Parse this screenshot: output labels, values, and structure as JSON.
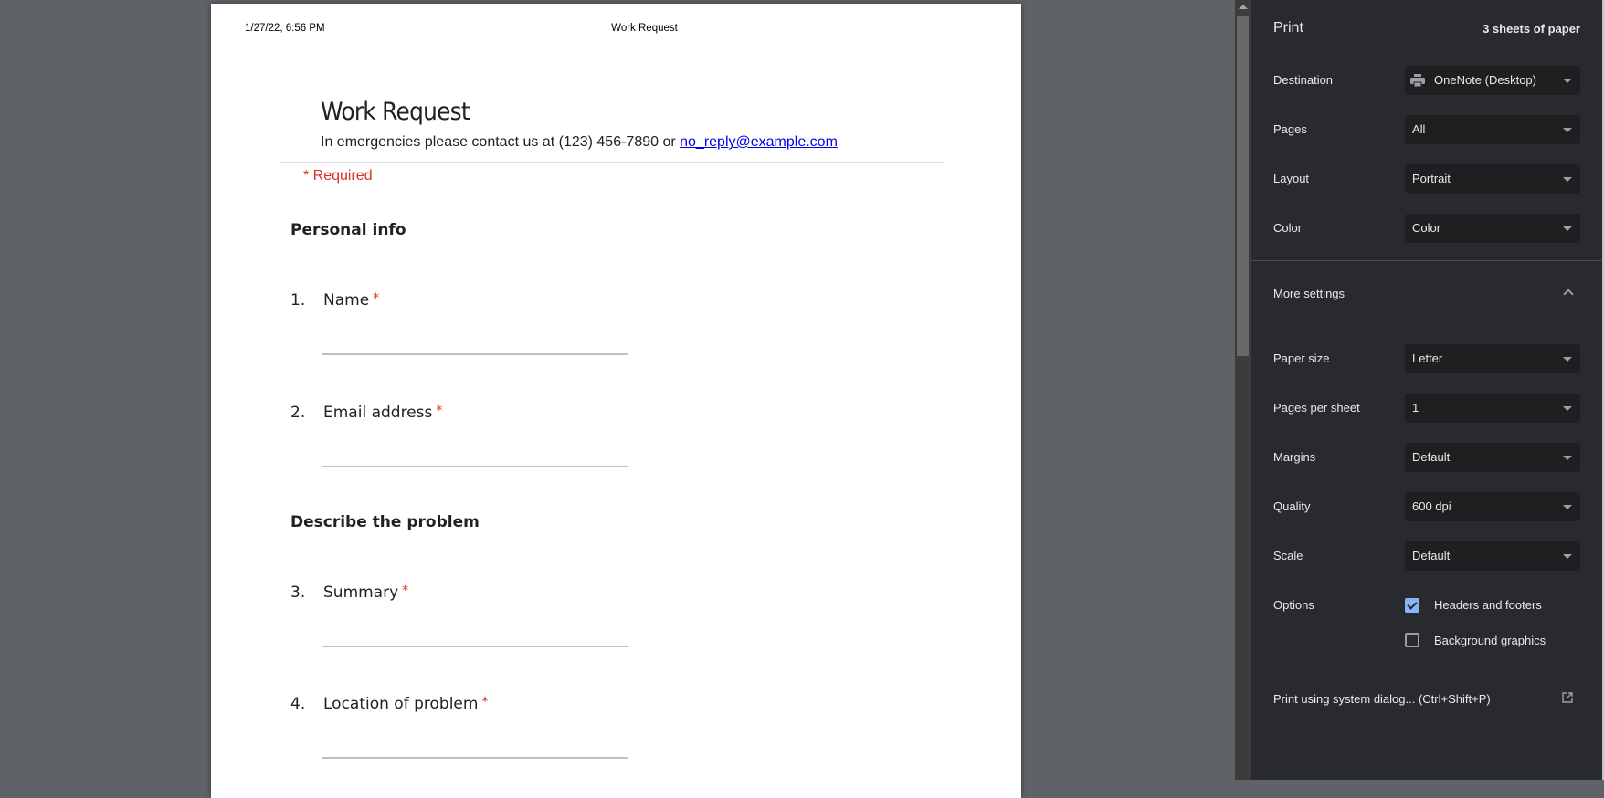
{
  "preview": {
    "header": {
      "date": "1/27/22, 6:56 PM",
      "title": "Work Request"
    },
    "form": {
      "title": "Work Request",
      "subtitle_text": "In emergencies please contact us at (123) 456-7890 or ",
      "subtitle_link": "no_reply@example.com",
      "required_note": "* Required",
      "sections": [
        {
          "title": "Personal info"
        },
        {
          "title": "Describe the problem"
        }
      ],
      "questions": [
        {
          "number": "1.",
          "label": "Name",
          "required_mark": "*"
        },
        {
          "number": "2.",
          "label": "Email address",
          "required_mark": "*"
        },
        {
          "number": "3.",
          "label": "Summary",
          "required_mark": "*"
        },
        {
          "number": "4.",
          "label": "Location of problem",
          "required_mark": "*"
        }
      ]
    }
  },
  "panel": {
    "title": "Print",
    "sheets": "3 sheets of paper",
    "settings": [
      {
        "label": "Destination",
        "value": "OneNote (Desktop)",
        "icon": "printer-icon"
      },
      {
        "label": "Pages",
        "value": "All"
      },
      {
        "label": "Layout",
        "value": "Portrait"
      },
      {
        "label": "Color",
        "value": "Color"
      }
    ],
    "more_settings": {
      "label": "More settings",
      "expanded": true,
      "icon": "chevron-up-icon"
    },
    "more": [
      {
        "label": "Paper size",
        "value": "Letter"
      },
      {
        "label": "Pages per sheet",
        "value": "1"
      },
      {
        "label": "Margins",
        "value": "Default"
      },
      {
        "label": "Quality",
        "value": "600 dpi"
      },
      {
        "label": "Scale",
        "value": "Default"
      }
    ],
    "options": {
      "label": "Options",
      "items": [
        {
          "label": "Headers and footers",
          "checked": true
        },
        {
          "label": "Background graphics",
          "checked": false
        }
      ]
    },
    "system_dialog": {
      "label": "Print using system dialog... (Ctrl+Shift+P)",
      "icon": "open-external-icon"
    }
  },
  "colors": {
    "panel_bg": "#292a2d",
    "select_bg": "#1f1f21",
    "accent": "#8ab4f8",
    "required_red": "#d93025",
    "preview_bg": "#5f6368"
  }
}
